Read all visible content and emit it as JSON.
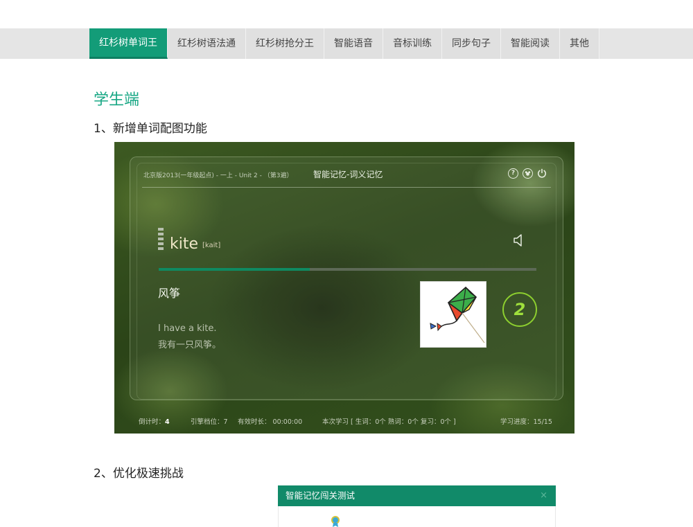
{
  "tabs": [
    {
      "label": "红杉树单词王",
      "active": true
    },
    {
      "label": "红杉树语法通"
    },
    {
      "label": "红杉树抢分王"
    },
    {
      "label": "智能语音"
    },
    {
      "label": "音标训练"
    },
    {
      "label": "同步句子"
    },
    {
      "label": "智能阅读"
    },
    {
      "label": "其他"
    }
  ],
  "section_title": "学生端",
  "items": [
    {
      "title": "1、新增单词配图功能"
    },
    {
      "title": "2、优化极速挑战"
    }
  ],
  "app": {
    "breadcrumb": "北京版2013(一年级起点) - 一上 - Unit 2 - （第3遍）",
    "title": "智能记忆-词义记忆",
    "header_icons": [
      "help-icon",
      "mascot-icon",
      "power-icon"
    ],
    "word": "kite",
    "phonetic": "[kait]",
    "progress_fraction": 0.4,
    "meaning": "风筝",
    "example_en": "I have a kite.",
    "example_cn": "我有一只风筝。",
    "picture": "kite-image",
    "count": "2",
    "status": {
      "countdown_label": "倒计时：",
      "countdown_value": "4",
      "engine": "引擎档位：7",
      "effective_time": "有效时长： 00:00:00",
      "session": "本次学习 [ 生词：0个   熟词：0个   复习：0个 ]",
      "progress": "学习进度：15/15"
    }
  },
  "dialog": {
    "title": "智能记忆闯关测试",
    "close": "×"
  },
  "colors": {
    "accent": "#139c78",
    "section_title": "#17a784",
    "dialog_header": "#118a69"
  }
}
